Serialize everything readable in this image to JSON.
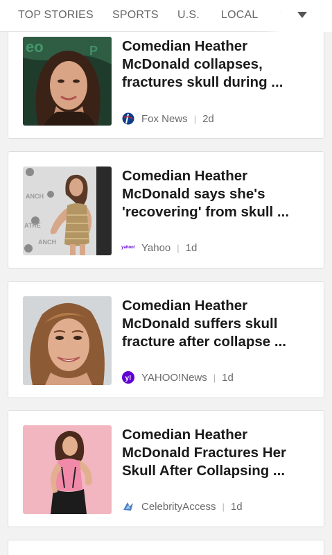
{
  "nav": {
    "tabs": [
      "TOP STORIES",
      "SPORTS",
      "U.S.",
      "LOCAL",
      "W"
    ],
    "more_icon": "chevron-down-icon"
  },
  "articles": [
    {
      "headline": "Comedian Heather McDonald collapses, fractures skull during ...",
      "source": "Fox News",
      "age": "2d",
      "source_icon": "fox-news-logo-icon",
      "image_desc": "woman-portrait-dark-hair"
    },
    {
      "headline": "Comedian Heather McDonald says she's 'recovering' from skull ...",
      "source": "Yahoo",
      "age": "1d",
      "source_icon": "yahoo-wordmark-icon",
      "source_icon_text": "yahoo!",
      "image_desc": "woman-red-carpet-gold-dress"
    },
    {
      "headline": "Comedian Heather McDonald suffers skull fracture after collapse ...",
      "source": "YAHOO!News",
      "age": "1d",
      "source_icon": "yahoo-y-logo-icon",
      "source_icon_text": "y!",
      "image_desc": "woman-smiling-headshot"
    },
    {
      "headline": "Comedian Heather McDonald Fractures Her Skull After Collapsing ...",
      "source": "CelebrityAccess",
      "age": "1d",
      "source_icon": "celebrityaccess-logo-icon",
      "image_desc": "woman-pink-background"
    }
  ],
  "colors": {
    "yahoo_purple": "#6001d2",
    "fox_blue": "#0b3f8c"
  }
}
